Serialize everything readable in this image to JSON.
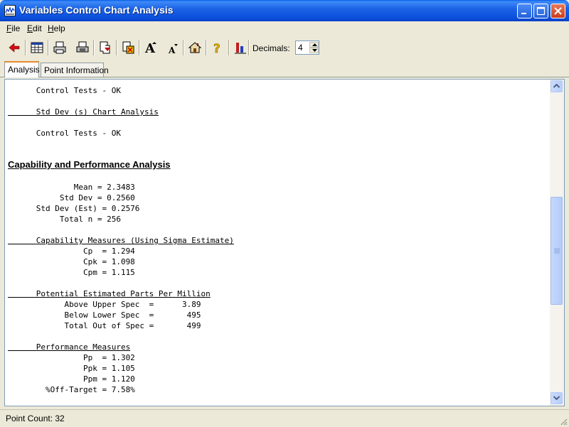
{
  "window": {
    "title": "Variables Control Chart Analysis"
  },
  "menu": {
    "file": "File",
    "edit": "Edit",
    "help": "Help"
  },
  "toolbar": {
    "buttons": [
      "back-icon",
      "grid-icon",
      "print-icon",
      "print-preview-icon",
      "copy-icon",
      "export-icon",
      "font-larger-icon",
      "font-smaller-icon",
      "home-icon",
      "help-icon",
      "chart-icon"
    ],
    "decimals_label": "Decimals:",
    "decimals_value": "4"
  },
  "tabs": {
    "analysis": "Analysis",
    "point_information": "Point Information"
  },
  "report": {
    "l1": "      Control Tests - OK",
    "l2": "      Std Dev (s) Chart Analysis",
    "l3": "      Control Tests - OK",
    "section_heading": "Capability and Performance Analysis",
    "mean": "              Mean = 2.3483",
    "std_dev": "           Std Dev = 0.2560",
    "std_dev_est": "      Std Dev (Est) = 0.2576",
    "total_n": "           Total n = 256",
    "capability_heading": "      Capability Measures (Using Sigma Estimate)",
    "cp": "                Cp  = 1.294",
    "cpk": "                Cpk = 1.098",
    "cpm": "                Cpm = 1.115",
    "ppm_heading": "      Potential Estimated Parts Per Million",
    "above_upper": "            Above Upper Spec  =      3.89",
    "below_lower": "            Below Lower Spec  =       495",
    "total_out": "            Total Out of Spec =       499",
    "performance_heading": "      Performance Measures",
    "pp": "                Pp  = 1.302",
    "ppk": "                Ppk = 1.105",
    "ppm": "                Ppm = 1.120",
    "off_target": "        %Off-Target = 7.58%"
  },
  "status": {
    "point_count": "Point Count: 32"
  },
  "colors": {
    "titlebar": "#0A4FDB",
    "accent_tab": "#E68B2C",
    "face": "#ECE9D8"
  }
}
